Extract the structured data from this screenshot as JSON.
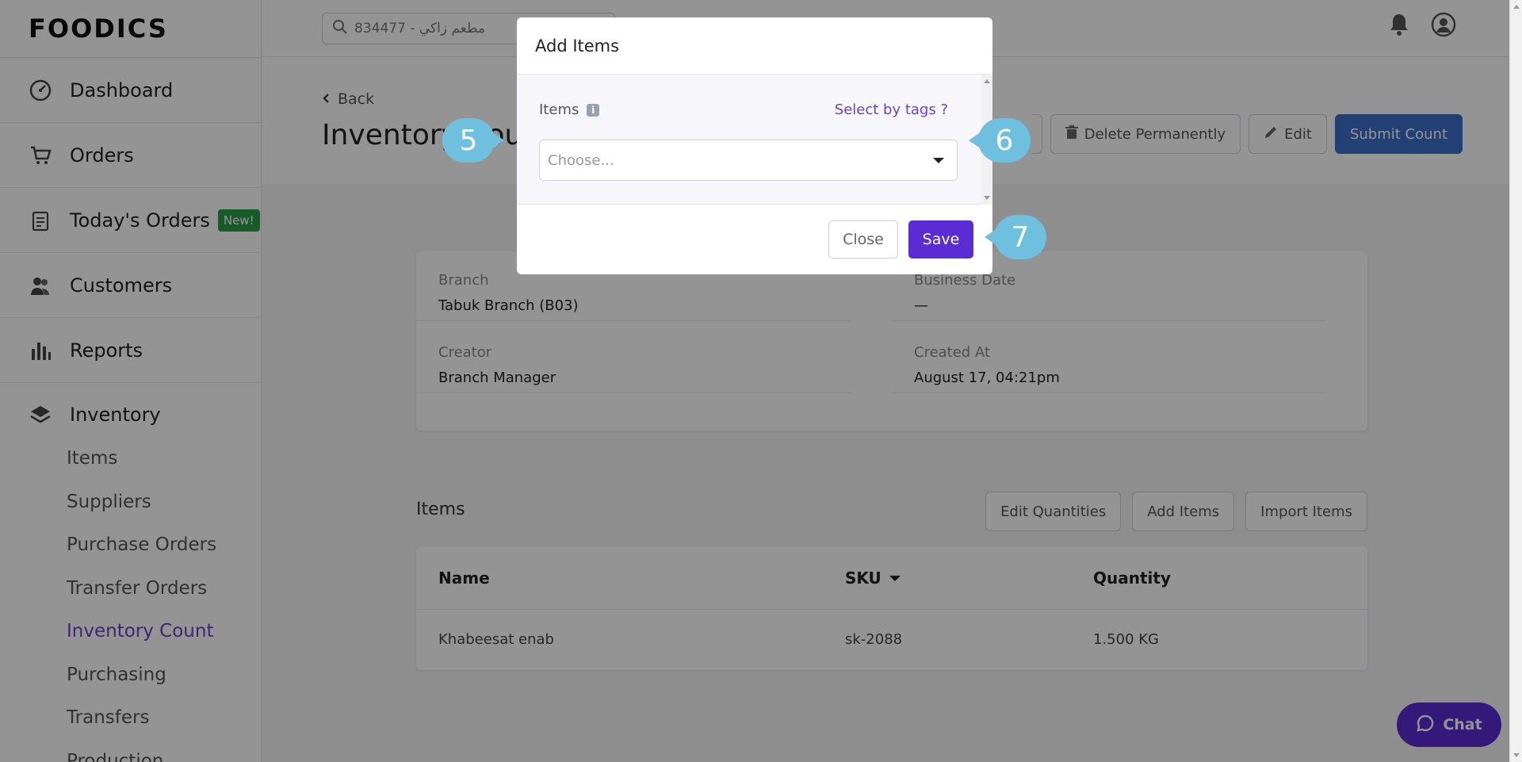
{
  "brand": {
    "logo_text": "FOODICS"
  },
  "sidebar": {
    "items": [
      {
        "label": "Dashboard",
        "icon": "gauge-icon"
      },
      {
        "label": "Orders",
        "icon": "cart-icon"
      },
      {
        "label": "Today's Orders",
        "icon": "clipboard-icon",
        "badge": "New!"
      },
      {
        "label": "Customers",
        "icon": "users-icon"
      },
      {
        "label": "Reports",
        "icon": "bar-chart-icon"
      }
    ],
    "inventory": {
      "label": "Inventory",
      "icon": "layers-icon",
      "sub_items": [
        "Items",
        "Suppliers",
        "Purchase Orders",
        "Transfer Orders",
        "Inventory Count",
        "Purchasing",
        "Transfers",
        "Production"
      ],
      "active": "Inventory Count"
    }
  },
  "topbar": {
    "search_value": "834477 - مطعم زاكي"
  },
  "header": {
    "back_label": "Back",
    "title": "Inventory Coun",
    "buttons": {
      "delete": "Delete Permanently",
      "edit": "Edit",
      "submit": "Submit Count"
    }
  },
  "details": {
    "branch_label": "Branch",
    "branch_value": "Tabuk Branch (B03)",
    "business_date_label": "Business Date",
    "business_date_value": "—",
    "creator_label": "Creator",
    "creator_value": "Branch Manager",
    "created_at_label": "Created At",
    "created_at_value": "August 17, 04:21pm"
  },
  "items_section": {
    "title": "Items",
    "actions": [
      "Edit Quantities",
      "Add Items",
      "Import Items"
    ],
    "columns": [
      "Name",
      "SKU",
      "Quantity"
    ],
    "rows": [
      {
        "name": "Khabeesat enab",
        "sku": "sk-2088",
        "quantity": "1.500 KG"
      }
    ]
  },
  "modal": {
    "title": "Add Items",
    "items_label": "Items",
    "select_by_tags": "Select by tags ?",
    "select_placeholder": "Choose...",
    "close_label": "Close",
    "save_label": "Save"
  },
  "callouts": [
    "5",
    "6",
    "7"
  ],
  "chat_label": "Chat",
  "colors": {
    "accent": "#5b2bd4",
    "primary_button": "#3b6fc9",
    "callout": "#6fbfdf",
    "link": "#6a42c9"
  }
}
